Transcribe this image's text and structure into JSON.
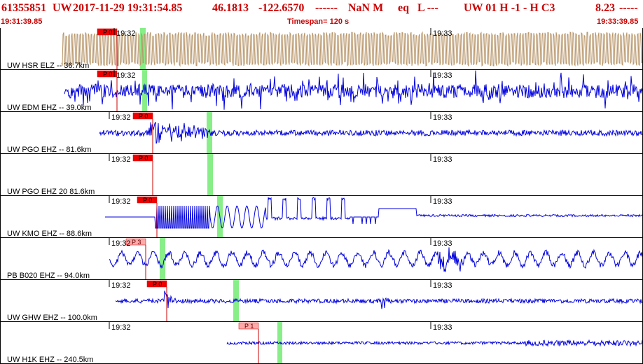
{
  "header": {
    "event_id": "61355851",
    "network": "UW",
    "origin_time": "2017-11-29 19:31:54.85",
    "lat": "46.1813",
    "lon": "-122.6570",
    "dashes1": "------",
    "magnitude": "NaN M",
    "event_type": "eq",
    "subtype": "L ---",
    "tail": "UW 01  H  -1  -  H C3",
    "value": "8.23",
    "dashes2": "-----"
  },
  "subheader": {
    "start_time": "19:31:39.85",
    "timespan": "Timespan= 120 s",
    "end_time": "19:33:39.85"
  },
  "colors": {
    "header_text": "#cc0000",
    "trace_blue": "#0000dd",
    "trace_tan": "#b8966a",
    "pick_red": "#ee0000",
    "pick_pink": "#ffaaaa",
    "marker_green": "#88ee88"
  },
  "channels": [
    {
      "label": "UW HSR ELZ -- 36.7km",
      "trace_color": "tan",
      "pick": "P 0",
      "pick_style": "solid",
      "time_label": "19:32",
      "time_label_2": "19:33"
    },
    {
      "label": "UW EDM EHZ -- 39.0km",
      "trace_color": "blue",
      "pick": "P 0",
      "pick_style": "solid",
      "time_label": "19:32",
      "time_label_2": "19:33"
    },
    {
      "label": "UW PGO EHZ -- 81.6km",
      "trace_color": "blue",
      "pick": "P 0",
      "pick_style": "solid",
      "time_label": "19:32",
      "time_label_2": "19:33"
    },
    {
      "label": "UW PGO EHZ 20 81.6km",
      "trace_color": "blue",
      "pick": "P 0",
      "pick_style": "solid",
      "time_label": "19:32",
      "time_label_2": "19:33"
    },
    {
      "label": "UW KMO EHZ -- 88.6km",
      "trace_color": "blue",
      "pick": "P 0",
      "pick_style": "solid",
      "time_label": "19:32",
      "time_label_2": "19:33"
    },
    {
      "label": "PB B020 EHZ -- 94.0km",
      "trace_color": "blue",
      "pick": "P 3",
      "pick_style": "pale",
      "time_label": "19:32",
      "time_label_2": "19:33"
    },
    {
      "label": "UW GHW EHZ -- 100.0km",
      "trace_color": "blue",
      "pick": "P 0",
      "pick_style": "solid",
      "time_label": "19:32",
      "time_label_2": "19:33"
    },
    {
      "label": "UW H1K EHZ -- 240.5km",
      "trace_color": "blue",
      "pick": "P 1",
      "pick_style": "pale",
      "time_label": "19:32",
      "time_label_2": "19:33"
    }
  ]
}
